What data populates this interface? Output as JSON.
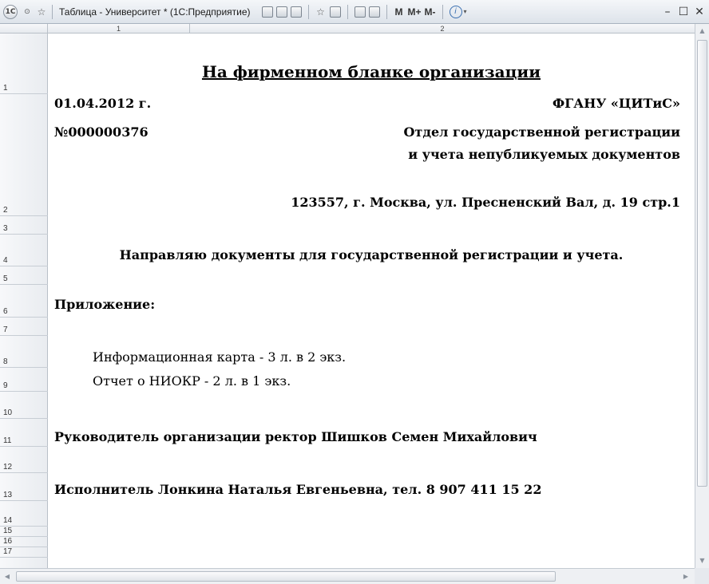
{
  "window": {
    "title": "Таблица - Университет * (1С:Предприятие)",
    "toolbar": {
      "m_label": "M",
      "mplus_label": "M+",
      "mminus_label": "M-"
    }
  },
  "columns": [
    "1",
    "2"
  ],
  "rows": [
    "1",
    "2",
    "3",
    "4",
    "5",
    "6",
    "7",
    "8",
    "9",
    "10",
    "11",
    "12",
    "13",
    "14",
    "15",
    "16",
    "17"
  ],
  "document": {
    "title": "На фирменном бланке организации",
    "date": "01.04.2012 г.",
    "number": "№000000376",
    "recipient_org": "ФГАНУ «ЦИТиС»",
    "recipient_dept_line1": "Отдел государственной регистрации",
    "recipient_dept_line2": "и учета непубликуемых документов",
    "address": "123557, г. Москва, ул. Пресненский Вал, д. 19 стр.1",
    "body": "Направляю документы для  государственной  регистрации и учета.",
    "attachment_label": "Приложение:",
    "attachments": [
      "Информационная карта - 3 л. в 2 экз.",
      "Отчет о НИОКР - 2 л. в 1 экз."
    ],
    "head": "Руководитель организации ректор Шишков Семен Михайлович",
    "executor": "Исполнитель Лонкина Наталья Евгеньевна, тел.  8 907 411 15 22"
  }
}
